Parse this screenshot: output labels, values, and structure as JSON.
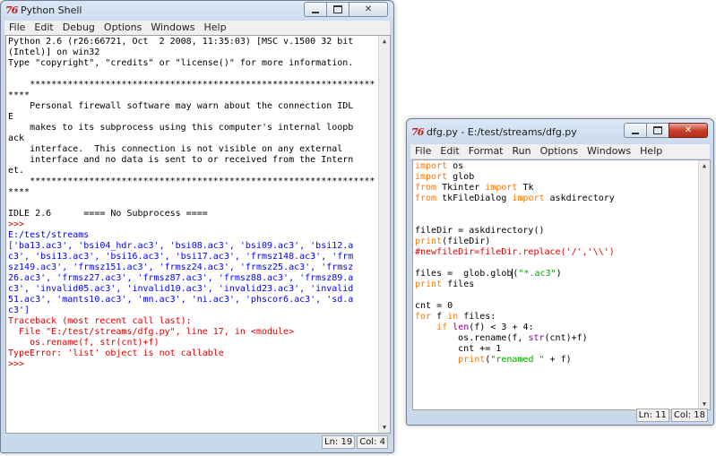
{
  "shell": {
    "title": "Python Shell",
    "menu": [
      "File",
      "Edit",
      "Debug",
      "Options",
      "Windows",
      "Help"
    ],
    "lines": [
      {
        "t": "Python 2.6 (r26:66721, Oct  2 2008, 11:35:03) [MSC v.1500 32 bit",
        "c": ""
      },
      {
        "t": "(Intel)] on win32",
        "c": ""
      },
      {
        "t": "Type \"copyright\", \"credits\" or \"license()\" for more information.",
        "c": ""
      },
      {
        "t": "",
        "c": ""
      },
      {
        "t": "    ****************************************************************",
        "c": ""
      },
      {
        "t": "****",
        "c": ""
      },
      {
        "t": "    Personal firewall software may warn about the connection IDL",
        "c": ""
      },
      {
        "t": "E",
        "c": ""
      },
      {
        "t": "    makes to its subprocess using this computer's internal loopb",
        "c": ""
      },
      {
        "t": "ack",
        "c": ""
      },
      {
        "t": "    interface.  This connection is not visible on any external",
        "c": ""
      },
      {
        "t": "    interface and no data is sent to or received from the Intern",
        "c": ""
      },
      {
        "t": "et.",
        "c": ""
      },
      {
        "t": "    ****************************************************************",
        "c": ""
      },
      {
        "t": "****",
        "c": ""
      },
      {
        "t": "",
        "c": ""
      },
      {
        "t": "IDLE 2.6      ==== No Subprocess ====",
        "c": ""
      },
      {
        "t": ">>>",
        "c": "pr"
      },
      {
        "t": "E:/test/streams",
        "c": "out"
      },
      {
        "t": "['ba13.ac3', 'bsi04_hdr.ac3', 'bsi08.ac3', 'bsi09.ac3', 'bsi12.a",
        "c": "out"
      },
      {
        "t": "c3', 'bsi13.ac3', 'bsi16.ac3', 'bsi17.ac3', 'frmsz148.ac3', 'frm",
        "c": "out"
      },
      {
        "t": "sz149.ac3', 'frmsz151.ac3', 'frmsz24.ac3', 'frmsz25.ac3', 'frmsz",
        "c": "out"
      },
      {
        "t": "26.ac3', 'frmsz27.ac3', 'frmsz87.ac3', 'frmsz88.ac3', 'frmsz89.a",
        "c": "out"
      },
      {
        "t": "c3', 'invalid05.ac3', 'invalid10.ac3', 'invalid23.ac3', 'invalid",
        "c": "out"
      },
      {
        "t": "51.ac3', 'mants10.ac3', 'mn.ac3', 'ni.ac3', 'phscor6.ac3', 'sd.a",
        "c": "out"
      },
      {
        "t": "c3']",
        "c": "out"
      },
      {
        "t": "Traceback (most recent call last):",
        "c": "err"
      },
      {
        "t": "  File \"E:/test/streams/dfg.py\", line 17, in <module>",
        "c": "err"
      },
      {
        "t": "    os.rename(f, str(cnt)+f)",
        "c": "err"
      },
      {
        "t": "TypeError: 'list' object is not callable",
        "c": "err"
      },
      {
        "t": ">>>",
        "c": "pr"
      }
    ],
    "status_ln": "Ln: 19",
    "status_col": "Col: 4"
  },
  "editor": {
    "title": "dfg.py - E:/test/streams/dfg.py",
    "menu": [
      "File",
      "Edit",
      "Format",
      "Run",
      "Options",
      "Windows",
      "Help"
    ],
    "code": [
      [
        [
          "import",
          "kw"
        ],
        [
          " os",
          ""
        ]
      ],
      [
        [
          "import",
          "kw"
        ],
        [
          " glob",
          ""
        ]
      ],
      [
        [
          "from",
          "kw"
        ],
        [
          " Tkinter ",
          ""
        ],
        [
          "import",
          "kw"
        ],
        [
          " Tk",
          ""
        ]
      ],
      [
        [
          "from",
          "kw"
        ],
        [
          " tkFileDialog ",
          ""
        ],
        [
          "import",
          "kw"
        ],
        [
          " askdirectory",
          ""
        ]
      ],
      [],
      [],
      [
        [
          "fileDir = askdirectory()",
          ""
        ]
      ],
      [
        [
          "print",
          "kw"
        ],
        [
          "(fileDir)",
          ""
        ]
      ],
      [
        [
          "#newfileDir=fileDir.replace('/','\\\\')",
          "cm"
        ]
      ],
      [],
      [
        [
          "files =  glob.glob",
          ""
        ],
        [
          "|",
          "cur"
        ],
        [
          "(",
          ""
        ],
        [
          "\"*.ac3\"",
          "st"
        ],
        [
          ")",
          ""
        ]
      ],
      [
        [
          "print",
          "kw"
        ],
        [
          " files",
          ""
        ]
      ],
      [],
      [
        [
          "cnt = 0",
          ""
        ]
      ],
      [
        [
          "for",
          "kw"
        ],
        [
          " f ",
          ""
        ],
        [
          "in",
          "kw"
        ],
        [
          " files:",
          ""
        ]
      ],
      [
        [
          "    ",
          ""
        ],
        [
          "if",
          "kw"
        ],
        [
          " ",
          ""
        ],
        [
          "len",
          "bi"
        ],
        [
          "(f) < 3 + 4:",
          ""
        ]
      ],
      [
        [
          "        os.rename(f, ",
          ""
        ],
        [
          "str",
          "bi"
        ],
        [
          "(cnt)+f)",
          ""
        ]
      ],
      [
        [
          "        cnt += 1",
          ""
        ]
      ],
      [
        [
          "        ",
          ""
        ],
        [
          "print",
          "kw"
        ],
        [
          "(",
          ""
        ],
        [
          "\"renamed \"",
          "st"
        ],
        [
          " + f)",
          ""
        ]
      ]
    ],
    "status_ln": "Ln: 11",
    "status_col": "Col: 18"
  }
}
